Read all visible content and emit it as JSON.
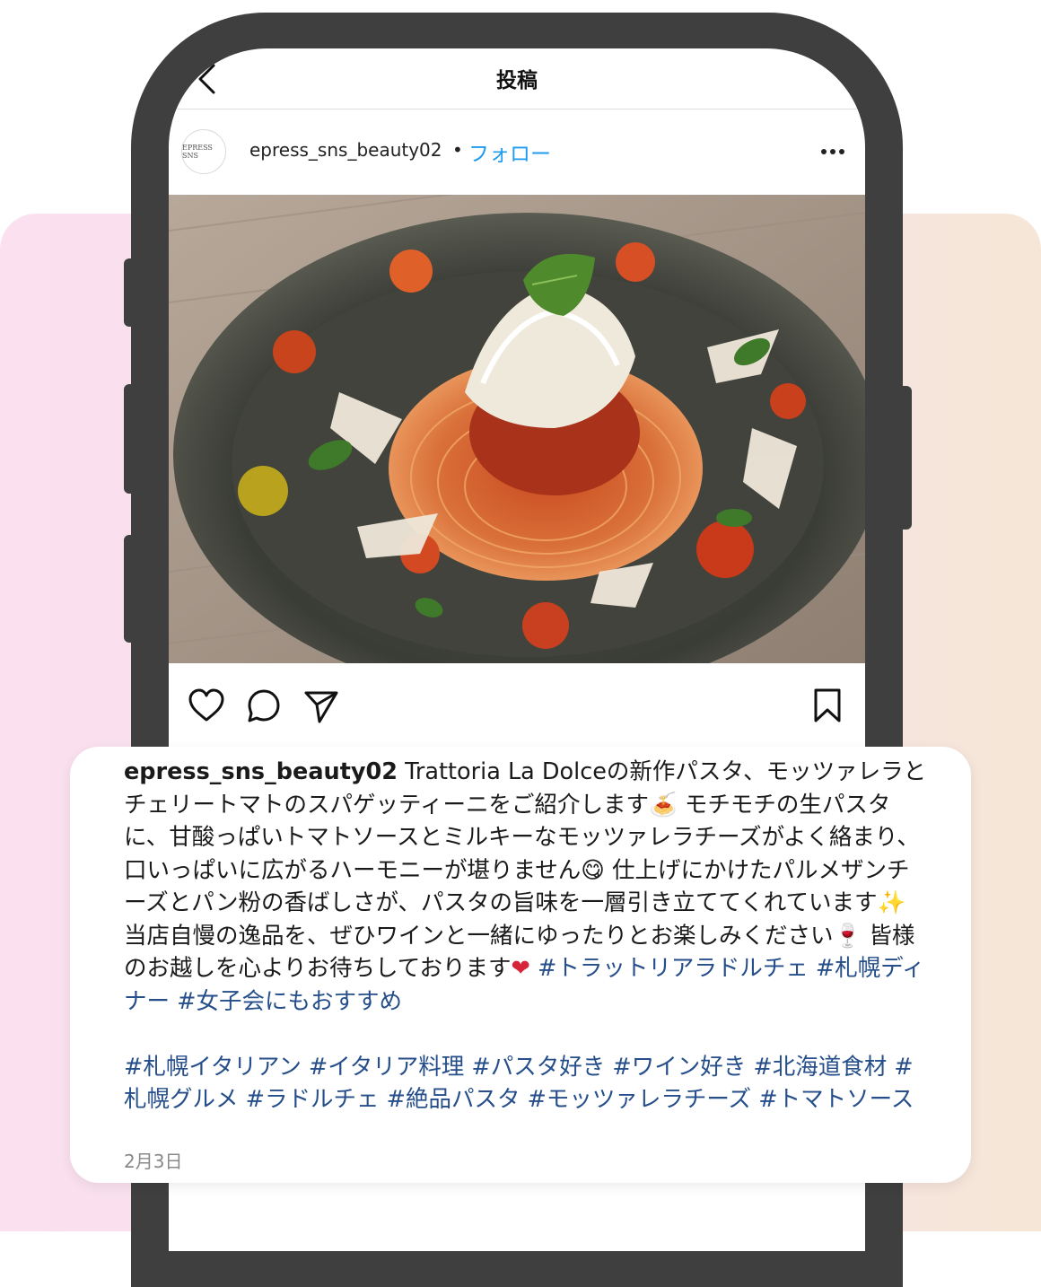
{
  "topbar": {
    "back_icon": "chevron-left-icon",
    "title": "投稿"
  },
  "post": {
    "avatar_text": "EPRESS SNS",
    "username": "epress_sns_beauty02",
    "separator": "•",
    "follow_label": "フォロー",
    "more_icon": "ellipsis-icon",
    "photo": "pasta-dish-photo"
  },
  "actions": {
    "icons": [
      "heart-icon",
      "comment-icon",
      "share-icon",
      "bookmark-icon"
    ]
  },
  "caption": {
    "username": "epress_sns_beauty02",
    "body_1": " Trattoria La Dolceの新作パスタ、モッツァレラとチェリートマトのスパゲッティーニをご紹介します",
    "emoji_1": "🍝",
    "body_2": " モチモチの生パスタに、甘酸っぱいトマトソースとミルキーなモッツァレラチーズがよく絡まり、口いっぱいに広がるハーモニーが堪りません",
    "emoji_2": "😋",
    "body_3": " 仕上げにかけたパルメザンチーズとパン粉の香ばしさが、パスタの旨味を一層引き立ててくれています",
    "emoji_3": "✨",
    "body_4": " 当店自慢の逸品を、ぜひワインと一緒にゆったりとお楽しみください",
    "emoji_4": "🍷",
    "body_5": " 皆様のお越しを心よりお待ちしております",
    "emoji_5": "❤",
    "hashtags_1": " #トラットリアラドルチェ #札幌ディナー #女子会にもおすすめ",
    "hashtags_2": "#札幌イタリアン #イタリア料理 #パスタ好き #ワイン好き #北海道食材 #札幌グルメ #ラドルチェ #絶品パスタ #モッツァレラチーズ #トマトソース",
    "date": "2月3日"
  },
  "colors": {
    "link": "#1d9bf0",
    "hashtag": "#254e8a",
    "phone_frame": "#3f3f3f"
  }
}
